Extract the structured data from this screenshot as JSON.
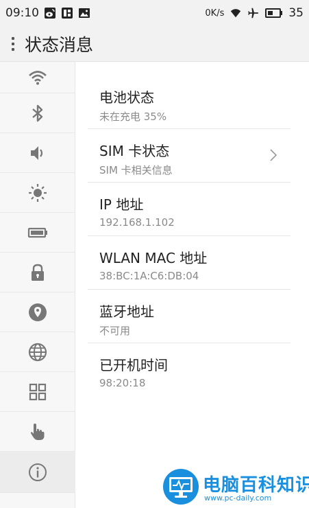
{
  "status_bar": {
    "time": "09:10",
    "data_speed": "0K/s",
    "battery": "35",
    "left_icons": [
      "weibo-icon",
      "tieba-icon",
      "image-icon"
    ],
    "right_icons": [
      "wifi-icon",
      "airplane-icon",
      "battery-icon"
    ]
  },
  "header": {
    "title": "状态消息",
    "menu_icon": "menu-dots-icon"
  },
  "sidebar": {
    "items": [
      {
        "icon": "wifi-icon"
      },
      {
        "icon": "bluetooth-icon"
      },
      {
        "icon": "volume-icon"
      },
      {
        "icon": "brightness-icon"
      },
      {
        "icon": "battery-icon"
      },
      {
        "icon": "lock-icon"
      },
      {
        "icon": "location-icon"
      },
      {
        "icon": "globe-icon"
      },
      {
        "icon": "apps-grid-icon"
      },
      {
        "icon": "touch-hand-icon"
      },
      {
        "icon": "info-icon",
        "active": true
      }
    ]
  },
  "rows": [
    {
      "label": "电池状态",
      "value": "未在充电   35%"
    },
    {
      "label": "SIM 卡状态",
      "value": "SIM 卡相关信息",
      "has_chevron": true
    },
    {
      "label": "IP 地址",
      "value": "192.168.1.102"
    },
    {
      "label": "WLAN MAC 地址",
      "value": "38:BC:1A:C6:DB:04"
    },
    {
      "label": "蓝牙地址",
      "value": "不可用"
    },
    {
      "label": "已开机时间",
      "value": "98:20:18"
    }
  ],
  "watermark": {
    "title": "电脑百科知识",
    "url": "www.pc-daily.com",
    "accent": "#1a8fdd"
  }
}
